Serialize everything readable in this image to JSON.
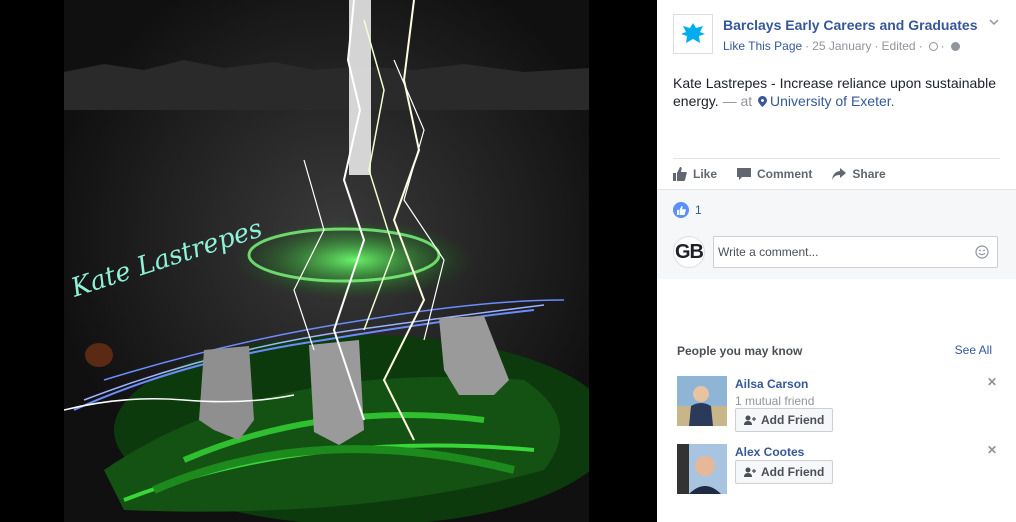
{
  "post": {
    "page_name": "Barclays Early Careers and Graduates",
    "like_page": "Like This Page",
    "date": "25 January",
    "edited": "Edited",
    "text": "Kate Lastrepes - Increase reliance upon sustainable energy.",
    "at_text": "— at",
    "location": "University of Exeter."
  },
  "actions": {
    "like": "Like",
    "comment": "Comment",
    "share": "Share"
  },
  "feedback": {
    "like_count": "1",
    "commenter_initials": "GB",
    "comment_placeholder": "Write a comment..."
  },
  "pymk": {
    "title": "People you may know",
    "see_all": "See All",
    "people": [
      {
        "name": "Ailsa Carson",
        "mutual": "1 mutual friend",
        "button": "Add Friend"
      },
      {
        "name": "Alex Cootes",
        "button": "Add Friend"
      }
    ]
  },
  "artwork": {
    "signature": "Kate Lastrepes"
  },
  "colors": {
    "link_blue": "#365899",
    "brand_blue": "#00aeef",
    "like_blue": "#5890ff"
  }
}
